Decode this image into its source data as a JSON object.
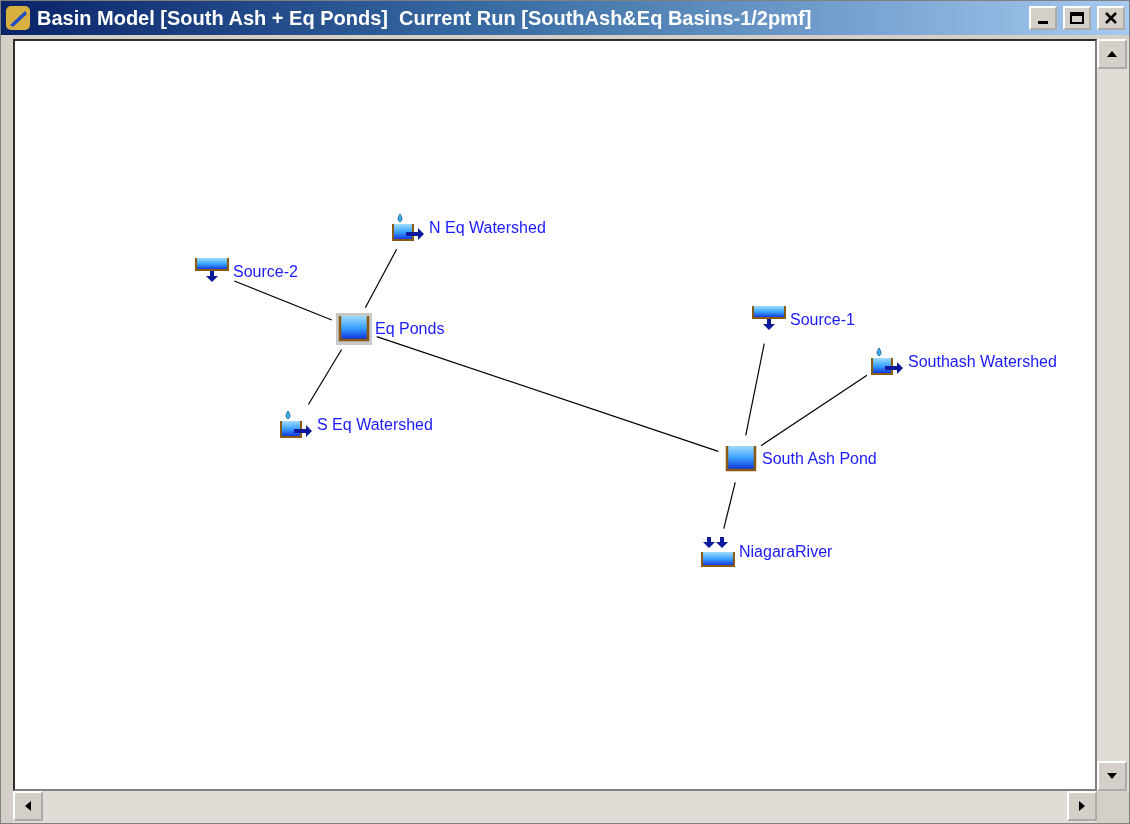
{
  "window": {
    "title": "Basin Model [South Ash + Eq Ponds]  Current Run [SouthAsh&Eq Basins-1/2pmf]"
  },
  "nodes": [
    {
      "name": "N Eq Watershed",
      "kind": "subbasin",
      "selected": false
    },
    {
      "name": "Source-2",
      "kind": "source",
      "selected": false
    },
    {
      "name": "Eq Ponds",
      "kind": "reservoir",
      "selected": true
    },
    {
      "name": "Source-1",
      "kind": "source",
      "selected": false
    },
    {
      "name": "Southash Watershed",
      "kind": "subbasin",
      "selected": false
    },
    {
      "name": "S Eq Watershed",
      "kind": "subbasin",
      "selected": false
    },
    {
      "name": "South Ash Pond",
      "kind": "reservoir",
      "selected": false
    },
    {
      "name": "NiagaraRiver",
      "kind": "sink",
      "selected": false
    }
  ]
}
